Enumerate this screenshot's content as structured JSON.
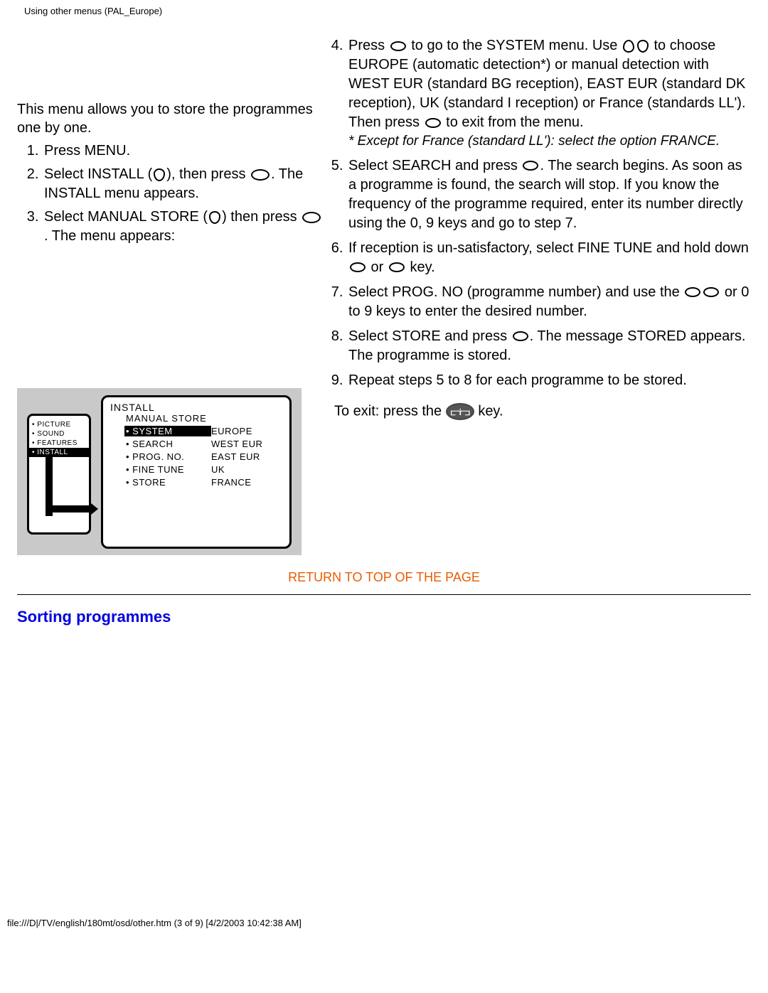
{
  "header_path": "Using other menus (PAL_Europe)",
  "intro": "This menu allows you to store the programmes one by one.",
  "steps_left": [
    {
      "pre": "Press MENU."
    },
    {
      "pre": "Select INSTALL (",
      "icon1": "down-icon",
      "mid1": "), then press ",
      "icon2": "right-oval-icon",
      "post": ". The INSTALL menu appears."
    },
    {
      "pre": "Select MANUAL STORE (",
      "icon1": "down-icon",
      "mid1": ") then press ",
      "icon2": "right-oval-icon",
      "post": ". The menu appears:"
    }
  ],
  "steps_right": [
    {
      "num": 4,
      "parts": [
        {
          "t": "Press "
        },
        {
          "icon": "right-oval-icon"
        },
        {
          "t": " to go to the SYSTEM menu. Use "
        },
        {
          "icon": "up-icon"
        },
        {
          "icon": "down-icon"
        },
        {
          "t": " to choose EUROPE (automatic detection*) or manual detection with WEST EUR (standard BG reception), EAST EUR (standard DK reception), UK (standard I reception) or France (standards LL'). Then press "
        },
        {
          "icon": "left-oval-icon"
        },
        {
          "t": " to exit from the menu."
        }
      ],
      "note": "* Except for France (standard LL'): select the option FRANCE."
    },
    {
      "num": 5,
      "parts": [
        {
          "t": "Select SEARCH and press "
        },
        {
          "icon": "right-oval-icon"
        },
        {
          "t": ". The search begins. As soon as a programme is found, the search will stop. If you know the frequency of the programme required, enter its number directly using the 0, 9 keys and go to step 7."
        }
      ]
    },
    {
      "num": 6,
      "parts": [
        {
          "t": "If reception is un-satisfactory, select FINE TUNE and hold down "
        },
        {
          "icon": "left-oval-icon"
        },
        {
          "t": " or "
        },
        {
          "icon": "right-oval-icon"
        },
        {
          "t": " key."
        }
      ]
    },
    {
      "num": 7,
      "parts": [
        {
          "t": "Select PROG. NO (programme number) and use the "
        },
        {
          "icon": "left-oval-icon"
        },
        {
          "icon": "right-oval-icon"
        },
        {
          "t": " or 0 to 9 keys to enter the desired number."
        }
      ]
    },
    {
      "num": 8,
      "parts": [
        {
          "t": "Select STORE and press "
        },
        {
          "icon": "right-oval-icon"
        },
        {
          "t": ". The message STORED appears. The programme is stored."
        }
      ]
    },
    {
      "num": 9,
      "parts": [
        {
          "t": "Repeat steps 5 to 8 for each programme to be stored."
        }
      ]
    }
  ],
  "exit": {
    "pre": "To exit: press the ",
    "button_label": "⫍i⫎",
    "post": " key."
  },
  "tv_menu": {
    "sidebar": [
      "PICTURE",
      "SOUND",
      "FEATURES",
      "INSTALL"
    ],
    "sidebar_active_index": 3,
    "panel_title": "INSTALL",
    "panel_sub": "MANUAL STORE",
    "rows": [
      {
        "l": "SYSTEM",
        "r": "EUROPE",
        "active": true
      },
      {
        "l": "SEARCH",
        "r": "WEST EUR"
      },
      {
        "l": "PROG. NO.",
        "r": "EAST EUR"
      },
      {
        "l": "FINE TUNE",
        "r": "UK"
      },
      {
        "l": "STORE",
        "r": "FRANCE"
      }
    ]
  },
  "return_link": "RETURN TO TOP OF THE PAGE",
  "sorting_title": "Sorting programmes",
  "footer": "file:///D|/TV/english/180mt/osd/other.htm (3 of 9) [4/2/2003 10:42:38 AM]"
}
